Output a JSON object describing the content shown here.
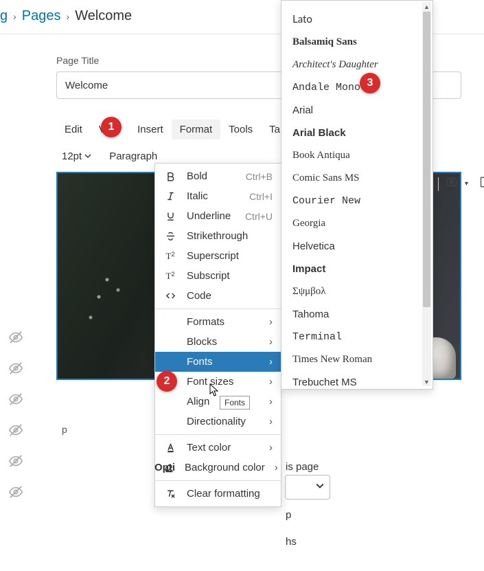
{
  "breadcrumb": {
    "level0": "g",
    "level1": "Pages",
    "current": "Welcome"
  },
  "page_title_label": "Page Title",
  "page_title_value": "Welcome",
  "menubar": [
    "Edit",
    "View",
    "Insert",
    "Format",
    "Tools",
    "Table"
  ],
  "toolbar": {
    "fontsize": "12pt",
    "paragraph": "Paragraph"
  },
  "format_menu": {
    "bold": "Bold",
    "bold_sc": "Ctrl+B",
    "italic": "Italic",
    "italic_sc": "Ctrl+I",
    "underline": "Underline",
    "underline_sc": "Ctrl+U",
    "strike": "Strikethrough",
    "superscript": "Superscript",
    "subscript": "Subscript",
    "code": "Code",
    "formats": "Formats",
    "blocks": "Blocks",
    "fonts": "Fonts",
    "font_sizes": "Font sizes",
    "align": "Align",
    "directionality": "Directionality",
    "text_color": "Text color",
    "bg_color": "Background color",
    "clear": "Clear formatting"
  },
  "fonts_tooltip": "Fonts",
  "fonts_list": [
    {
      "label": "Lato",
      "style": "font-family: Lato, sans-serif;"
    },
    {
      "label": "Balsamiq Sans",
      "style": "font-family: 'Comic Sans MS', cursive; font-weight: 600;"
    },
    {
      "label": "Architect's Daughter",
      "style": "font-family: cursive; font-style: italic;"
    },
    {
      "label": "Andale Mono",
      "style": "font-family: 'Andale Mono', monospace;"
    },
    {
      "label": "Arial",
      "style": "font-family: Arial, sans-serif;"
    },
    {
      "label": "Arial Black",
      "style": "font-family: 'Arial Black', sans-serif; font-weight: 900;"
    },
    {
      "label": "Book Antiqua",
      "style": "font-family: 'Book Antiqua', 'Palatino Linotype', serif;"
    },
    {
      "label": "Comic Sans MS",
      "style": "font-family: 'Comic Sans MS', cursive;"
    },
    {
      "label": "Courier New",
      "style": "font-family: 'Courier New', monospace;"
    },
    {
      "label": "Georgia",
      "style": "font-family: Georgia, serif;"
    },
    {
      "label": "Helvetica",
      "style": "font-family: Helvetica, Arial, sans-serif;"
    },
    {
      "label": "Impact",
      "style": "font-family: Impact, sans-serif; font-weight: 700;"
    },
    {
      "label": "Σψμβολ",
      "style": "font-family: Symbol, serif;"
    },
    {
      "label": "Tahoma",
      "style": "font-family: Tahoma, sans-serif;"
    },
    {
      "label": "Terminal",
      "style": "font-family: Terminal, 'Courier New', monospace;"
    },
    {
      "label": "Times New Roman",
      "style": "font-family: 'Times New Roman', serif;"
    },
    {
      "label": "Trebuchet MS",
      "style": "font-family: 'Trebuchet MS', sans-serif;"
    }
  ],
  "steps": {
    "one": "1",
    "two": "2",
    "three": "3"
  },
  "path": "p",
  "options_label": "Opti",
  "peek": {
    "p1": "is page",
    "p2": "p",
    "p3": "hs"
  }
}
